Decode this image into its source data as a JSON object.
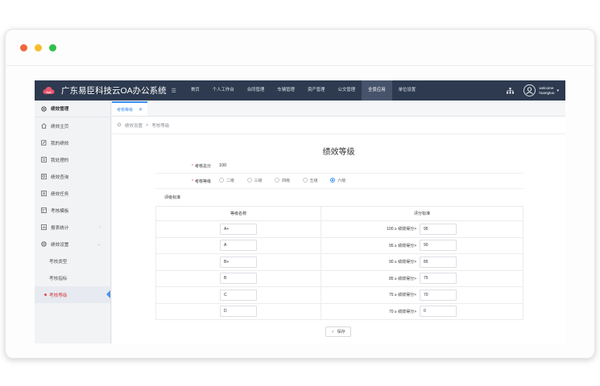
{
  "window": {
    "dots": [
      "#f0673d",
      "#f7bd2c",
      "#2fc14c"
    ]
  },
  "app": {
    "title": "广东易臣科技云OA办公系统",
    "menu_toggle": "☰",
    "nav": [
      "首页",
      "个人工作台",
      "合同管理",
      "车辆管理",
      "资产管理",
      "公文管理",
      "全景应用",
      "单位设置"
    ],
    "active_nav": "全景应用",
    "user": {
      "line1": "welcome",
      "line2": "huangtuo"
    }
  },
  "sidebar": {
    "header": "绩效管理",
    "items": [
      {
        "label": "绩效主页",
        "icon": "home-icon"
      },
      {
        "label": "我的绩效",
        "icon": "edit-icon"
      },
      {
        "label": "我处理的",
        "icon": "list-icon"
      },
      {
        "label": "绩效查询",
        "icon": "search-icon"
      },
      {
        "label": "绩效任务",
        "icon": "task-icon"
      },
      {
        "label": "考核模板",
        "icon": "template-icon"
      },
      {
        "label": "报表统计",
        "icon": "chart-icon",
        "arrow": "›"
      },
      {
        "label": "绩效设置",
        "icon": "gear-icon",
        "arrow": "⌄"
      }
    ],
    "sub_items": [
      "考核类型",
      "考核指标",
      "考核等级"
    ]
  },
  "tab": {
    "label": "考核等级",
    "close": "✕"
  },
  "breadcrumb": {
    "parent": "绩效设置",
    "separator": ">",
    "current": "考核等级"
  },
  "page": {
    "title": "绩效等级",
    "total_label": "考核总分",
    "total_value": "100",
    "grade_label": "考核等级",
    "grade_options": [
      "二级",
      "三级",
      "四级",
      "五级",
      "六级"
    ],
    "grade_selected": "六级",
    "criteria_label": "评级标准",
    "col_name": "等级名称",
    "col_score": "评分标准",
    "rows": [
      {
        "name": "A+",
        "rule": "100 ≥ 绩效得分>",
        "score": "95"
      },
      {
        "name": "A",
        "rule": "95 ≥ 绩效得分>",
        "score": "90"
      },
      {
        "name": "B+",
        "rule": "90 ≥ 绩效得分>",
        "score": "85"
      },
      {
        "name": "B",
        "rule": "85 ≥ 绩效得分>",
        "score": "75"
      },
      {
        "name": "C",
        "rule": "75 ≥ 绩效得分>",
        "score": "70"
      },
      {
        "name": "D",
        "rule": "70 ≥ 绩效得分>",
        "score": "0"
      }
    ],
    "save_label": "保存",
    "save_icon": "✓"
  }
}
